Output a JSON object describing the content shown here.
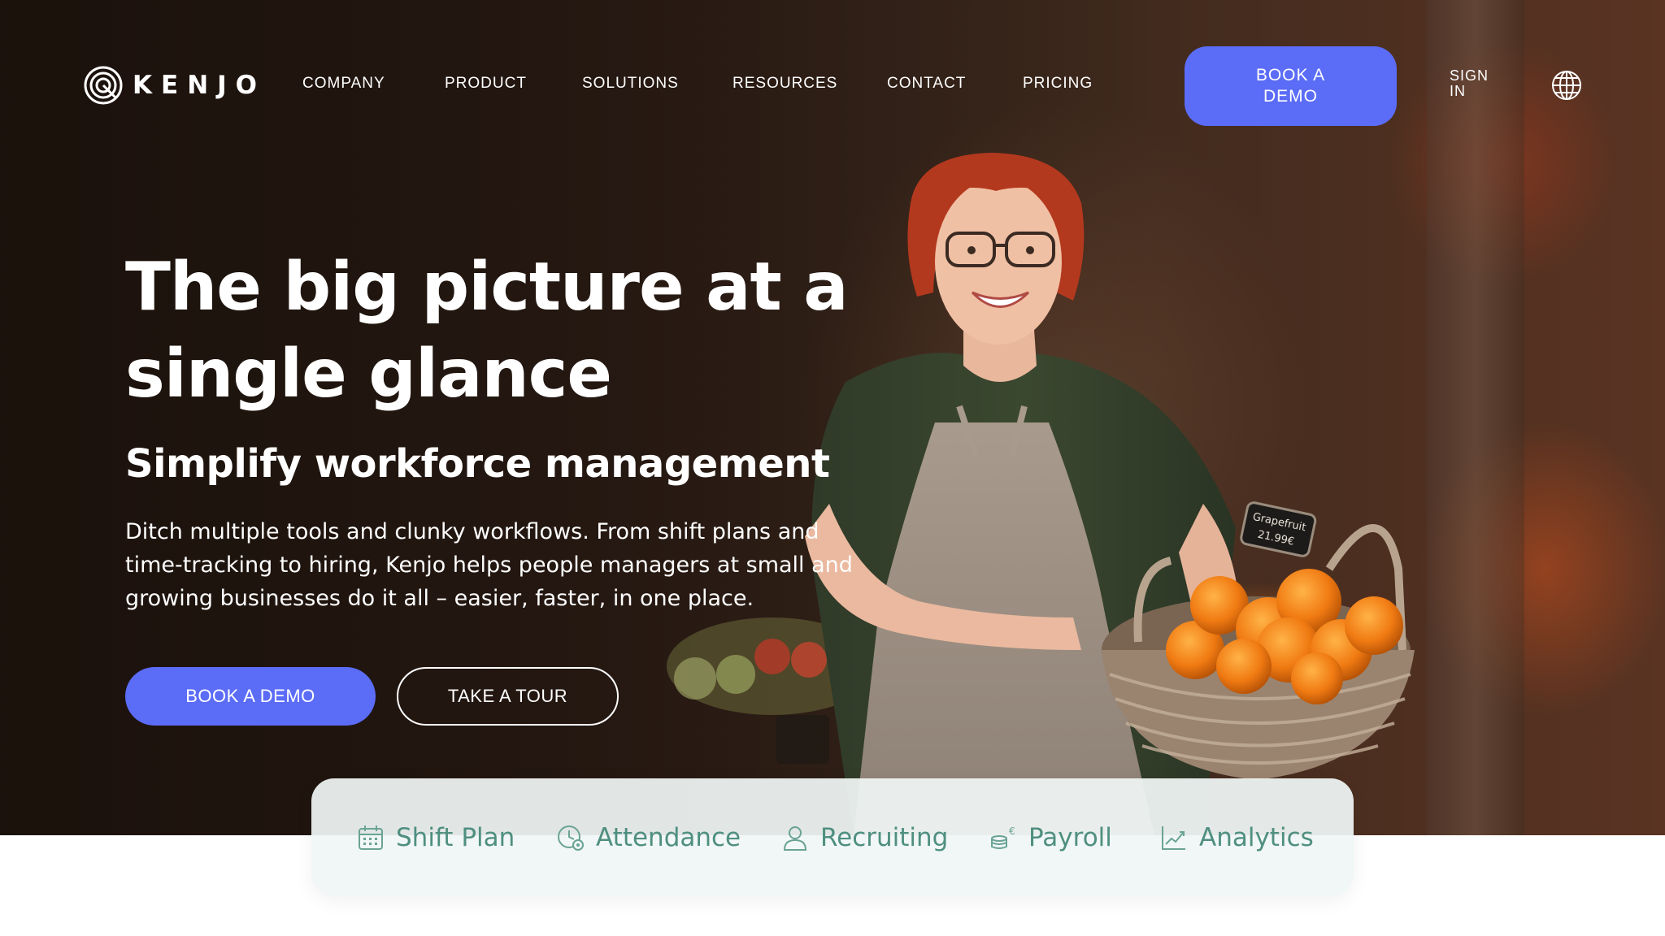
{
  "brand": {
    "name": "KENJO",
    "logo_icon": "kenjo-spiral-logo"
  },
  "nav": {
    "links": [
      {
        "label": "COMPANY"
      },
      {
        "label": "PRODUCT"
      },
      {
        "label": "SOLUTIONS"
      },
      {
        "label": "RESOURCES"
      },
      {
        "label": "CONTACT"
      },
      {
        "label": "PRICING"
      }
    ],
    "cta_label": "BOOK A DEMO",
    "sign_in_label": "SIGN IN",
    "language_icon": "globe-icon"
  },
  "hero": {
    "headline": "The big picture at a single glance",
    "subheadline": "Simplify workforce management",
    "description": "Ditch multiple tools and clunky workflows. From shift plans and time-tracking to hiring, Kenjo helps people managers at small and growing businesses do it all – easier, faster, in one place.",
    "primary_button": "BOOK A DEMO",
    "secondary_button": "TAKE A TOUR",
    "basket_tag": "Grapefruit 21.99€"
  },
  "features": [
    {
      "label": "Shift Plan",
      "icon": "calendar-icon"
    },
    {
      "label": "Attendance",
      "icon": "clock-icon"
    },
    {
      "label": "Recruiting",
      "icon": "person-icon"
    },
    {
      "label": "Payroll",
      "icon": "coins-euro-icon"
    },
    {
      "label": "Analytics",
      "icon": "chart-line-icon"
    }
  ],
  "colors": {
    "accent": "#5b6cf7",
    "feature_text": "#4f8f80",
    "feature_bar_bg": "#f0f6f5",
    "hero_dark": "#2c1d15"
  }
}
